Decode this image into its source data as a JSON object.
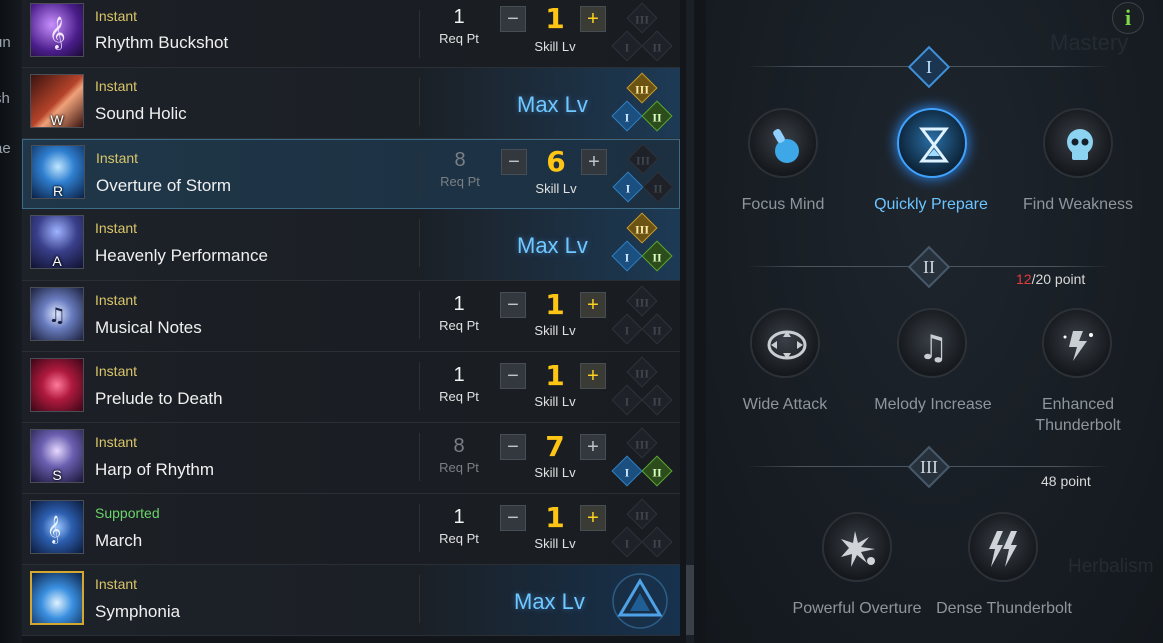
{
  "left_edge": [
    "un",
    "sh",
    "ae"
  ],
  "skills": [
    {
      "type": "Instant",
      "name": "Rhythm Buckshot",
      "key": "",
      "state": "normal",
      "req_pt": "1",
      "req_label": "Req Pt",
      "level": "1",
      "level_label": "Skill Lv",
      "plus_active": true,
      "tripods": [
        "off",
        "off",
        "off"
      ]
    },
    {
      "type": "Instant",
      "name": "Sound Holic",
      "key": "W",
      "state": "max",
      "max_label": "Max Lv",
      "tripods": [
        "gold",
        "blue",
        "green"
      ]
    },
    {
      "type": "Instant",
      "name": "Overture of Storm",
      "key": "R",
      "state": "selected",
      "req_pt": "8",
      "req_label": "Req Pt",
      "req_dim": true,
      "level": "6",
      "level_label": "Skill Lv",
      "plus_active": false,
      "tripods": [
        "off",
        "blue",
        "off"
      ]
    },
    {
      "type": "Instant",
      "name": "Heavenly Performance",
      "key": "A",
      "state": "max",
      "max_label": "Max Lv",
      "tripods": [
        "gold",
        "blue",
        "green"
      ]
    },
    {
      "type": "Instant",
      "name": "Musical Notes",
      "key": "",
      "state": "normal",
      "req_pt": "1",
      "req_label": "Req Pt",
      "level": "1",
      "level_label": "Skill Lv",
      "plus_active": true,
      "tripods": [
        "off",
        "off",
        "off"
      ]
    },
    {
      "type": "Instant",
      "name": "Prelude to Death",
      "key": "",
      "state": "normal",
      "req_pt": "1",
      "req_label": "Req Pt",
      "level": "1",
      "level_label": "Skill Lv",
      "plus_active": true,
      "tripods": [
        "off",
        "off",
        "off"
      ]
    },
    {
      "type": "Instant",
      "name": "Harp of Rhythm",
      "key": "S",
      "state": "normal",
      "req_pt": "8",
      "req_label": "Req Pt",
      "req_dim": true,
      "level": "7",
      "level_label": "Skill Lv",
      "plus_active": false,
      "tripods": [
        "off",
        "blue",
        "green"
      ]
    },
    {
      "type": "Supported",
      "name": "March",
      "key": "",
      "state": "normal",
      "req_pt": "1",
      "req_label": "Req Pt",
      "level": "1",
      "level_label": "Skill Lv",
      "plus_active": true,
      "tripods": [
        "off",
        "off",
        "off"
      ]
    },
    {
      "type": "Instant",
      "name": "Symphonia",
      "key": "",
      "state": "awakening",
      "max_label": "Max Lv"
    }
  ],
  "engravings": {
    "info_icon": "i",
    "tiers": [
      {
        "numeral": "I",
        "points": "",
        "active": true,
        "skills": [
          {
            "name": "Focus Mind",
            "icon": "potion-icon",
            "active": false
          },
          {
            "name": "Quickly Prepare",
            "icon": "hourglass-icon",
            "active": true
          },
          {
            "name": "Find Weakness",
            "icon": "skull-icon",
            "active": false
          }
        ]
      },
      {
        "numeral": "II",
        "points_current": "12",
        "points_total": "/20 point",
        "active": false,
        "skills": [
          {
            "name": "Wide Attack",
            "icon": "arrows-icon",
            "active": false
          },
          {
            "name": "Melody Increase",
            "icon": "music-note-icon",
            "active": false
          },
          {
            "name": "Enhanced Thunderbolt",
            "icon": "thunder-hand-icon",
            "active": false
          }
        ]
      },
      {
        "numeral": "III",
        "points": "48 point",
        "active": false,
        "skills": [
          {
            "name": "Powerful Overture",
            "icon": "burst-icon",
            "active": false
          },
          {
            "name": "Dense Thunderbolt",
            "icon": "lightning-icon",
            "active": false
          }
        ]
      }
    ]
  },
  "background_text": [
    "Mastery",
    "Herbalism"
  ],
  "colors": {
    "gold": "#ffc515",
    "maxlv": "#6fc8ff",
    "active_blue": "#6cc4ff",
    "supported": "#6ad46a",
    "instant": "#d9c56a"
  }
}
